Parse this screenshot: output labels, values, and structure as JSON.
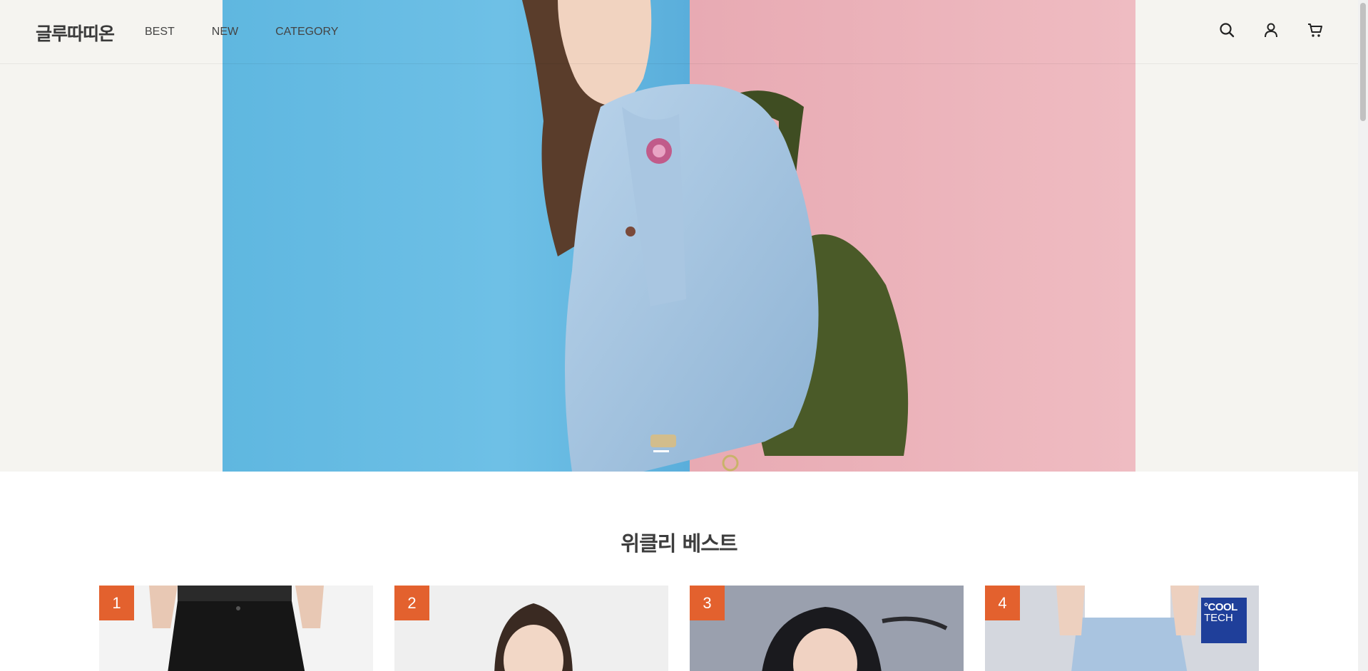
{
  "brand": {
    "logo_text": "글루따띠온"
  },
  "nav": {
    "items": [
      "BEST",
      "NEW",
      "CATEGORY"
    ]
  },
  "header_icons": [
    "search-icon",
    "user-icon",
    "cart-icon"
  ],
  "hero": {
    "slides_total": 2,
    "active_slide": 1,
    "image": "woman-in-denim-jacket-with-green-backpack"
  },
  "weekly_best": {
    "title": "위클리 베스트",
    "products": [
      {
        "rank": "1",
        "image": "black-cargo-pants"
      },
      {
        "rank": "2",
        "image": "model-portrait"
      },
      {
        "rank": "3",
        "image": "smiling-model"
      },
      {
        "rank": "4",
        "image": "light-denim-jeans",
        "badge_line1": "°COOL",
        "badge_line2": "TECH"
      }
    ]
  },
  "colors": {
    "accent": "#e3612e",
    "hero_bg": "#f5f4f0",
    "badge_blue": "#1f3f9a"
  }
}
